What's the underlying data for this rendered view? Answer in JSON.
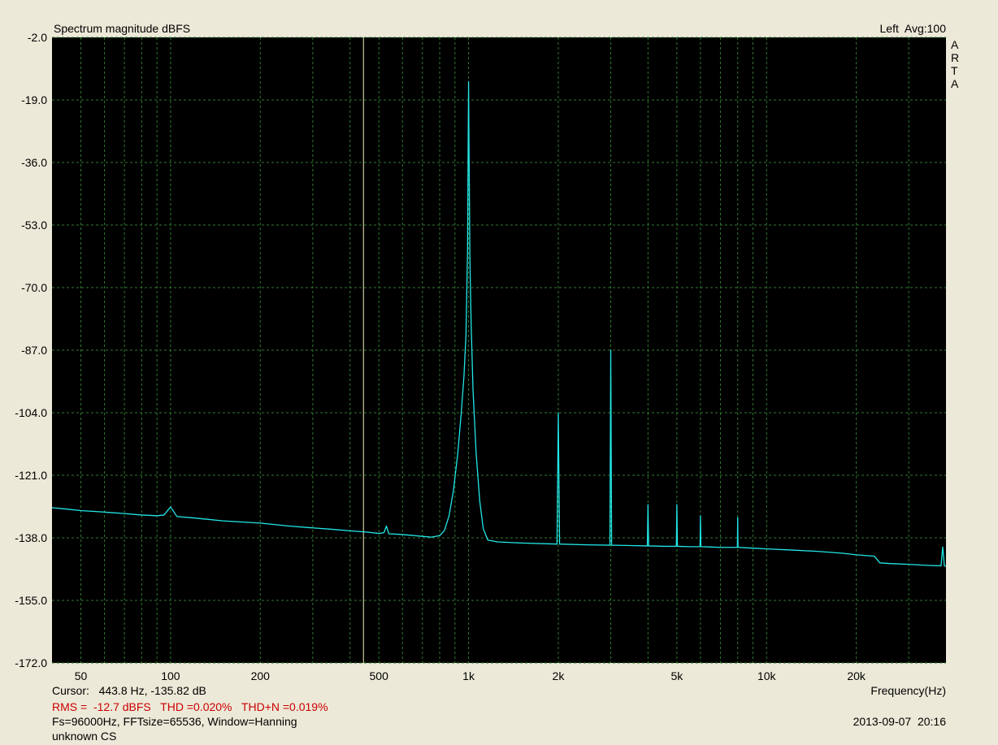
{
  "header": {
    "title": "Spectrum magnitude dBFS",
    "channel": "Left  Avg:100",
    "brand_letters": [
      "A",
      "R",
      "T",
      "A"
    ]
  },
  "footer": {
    "cursor": "Cursor:   443.8 Hz, -135.82 dB",
    "freq_label": "Frequency(Hz)",
    "stats": "RMS =  -12.7 dBFS   THD =0.020%   THD+N =0.019%",
    "fft": "Fs=96000Hz, FFTsize=65536, Window=Hanning",
    "timestamp": "2013-09-07  20:16",
    "device": "unknown CS"
  },
  "colors": {
    "background": "#ece9d8",
    "plot_bg": "#000000",
    "grid": "#2f7a2f",
    "trace": "#22e6e6",
    "cursor": "#f5f0c0",
    "stats_text": "#cc0000"
  },
  "chart_data": {
    "type": "line",
    "xscale": "log",
    "xlim": [
      40,
      40000
    ],
    "ylim": [
      -172,
      -2
    ],
    "grid": true,
    "yticks": [
      -2.0,
      -19.0,
      -36.0,
      -53.0,
      -70.0,
      -87.0,
      -104.0,
      -121.0,
      -138.0,
      -155.0,
      -172.0
    ],
    "ytick_labels": [
      "-2.0",
      "-19.0",
      "-36.0",
      "-53.0",
      "-70.0",
      "-87.0",
      "-104.0",
      "-121.0",
      "-138.0",
      "-155.0",
      "-172.0"
    ],
    "xticks": [
      50,
      100,
      200,
      500,
      1000,
      2000,
      5000,
      10000,
      20000
    ],
    "xtick_labels": [
      "50",
      "100",
      "200",
      "500",
      "1k",
      "2k",
      "5k",
      "10k",
      "20k"
    ],
    "cursor_x": 443.8,
    "series": [
      {
        "points": [
          [
            40,
            -129.8
          ],
          [
            45,
            -130.2
          ],
          [
            50,
            -130.6
          ],
          [
            60,
            -131.0
          ],
          [
            70,
            -131.4
          ],
          [
            80,
            -131.8
          ],
          [
            90,
            -132.0
          ],
          [
            95,
            -131.8
          ],
          [
            100,
            -129.6
          ],
          [
            105,
            -132.2
          ],
          [
            120,
            -132.6
          ],
          [
            150,
            -133.4
          ],
          [
            200,
            -134.0
          ],
          [
            250,
            -134.8
          ],
          [
            300,
            -135.3
          ],
          [
            350,
            -135.7
          ],
          [
            400,
            -136.1
          ],
          [
            450,
            -136.4
          ],
          [
            500,
            -136.8
          ],
          [
            520,
            -136.6
          ],
          [
            530,
            -134.8
          ],
          [
            540,
            -136.9
          ],
          [
            600,
            -137.1
          ],
          [
            700,
            -137.6
          ],
          [
            750,
            -137.8
          ],
          [
            800,
            -137.4
          ],
          [
            830,
            -136.0
          ],
          [
            860,
            -132.0
          ],
          [
            890,
            -125.0
          ],
          [
            920,
            -115.0
          ],
          [
            945,
            -104.0
          ],
          [
            965,
            -94.0
          ],
          [
            980,
            -83.0
          ],
          [
            992,
            -60.0
          ],
          [
            997,
            -30.0
          ],
          [
            1000,
            -14.0
          ],
          [
            1003,
            -30.0
          ],
          [
            1010,
            -62.0
          ],
          [
            1020,
            -80.0
          ],
          [
            1035,
            -98.0
          ],
          [
            1060,
            -115.0
          ],
          [
            1090,
            -128.0
          ],
          [
            1120,
            -135.5
          ],
          [
            1160,
            -138.6
          ],
          [
            1250,
            -139.1
          ],
          [
            1500,
            -139.4
          ],
          [
            1980,
            -139.7
          ],
          [
            2000,
            -104.0
          ],
          [
            2020,
            -139.7
          ],
          [
            2500,
            -139.9
          ],
          [
            2980,
            -140.0
          ],
          [
            3000,
            -87.0
          ],
          [
            3020,
            -140.0
          ],
          [
            3500,
            -140.1
          ],
          [
            3980,
            -140.2
          ],
          [
            4000,
            -129.0
          ],
          [
            4020,
            -140.2
          ],
          [
            4500,
            -140.3
          ],
          [
            4980,
            -140.3
          ],
          [
            5000,
            -129.0
          ],
          [
            5020,
            -140.3
          ],
          [
            5500,
            -140.4
          ],
          [
            5980,
            -140.4
          ],
          [
            6000,
            -132.0
          ],
          [
            6020,
            -140.4
          ],
          [
            6500,
            -140.5
          ],
          [
            7000,
            -140.6
          ],
          [
            7980,
            -140.6
          ],
          [
            8000,
            -132.5
          ],
          [
            8020,
            -140.6
          ],
          [
            9000,
            -140.8
          ],
          [
            10000,
            -141.0
          ],
          [
            12000,
            -141.3
          ],
          [
            15000,
            -141.7
          ],
          [
            18000,
            -142.2
          ],
          [
            20000,
            -142.6
          ],
          [
            23000,
            -143.0
          ],
          [
            24000,
            -144.8
          ],
          [
            26000,
            -145.0
          ],
          [
            30000,
            -145.2
          ],
          [
            35000,
            -145.5
          ],
          [
            38500,
            -145.6
          ],
          [
            39000,
            -140.5
          ],
          [
            39500,
            -145.6
          ],
          [
            40000,
            -145.7
          ]
        ]
      }
    ]
  }
}
